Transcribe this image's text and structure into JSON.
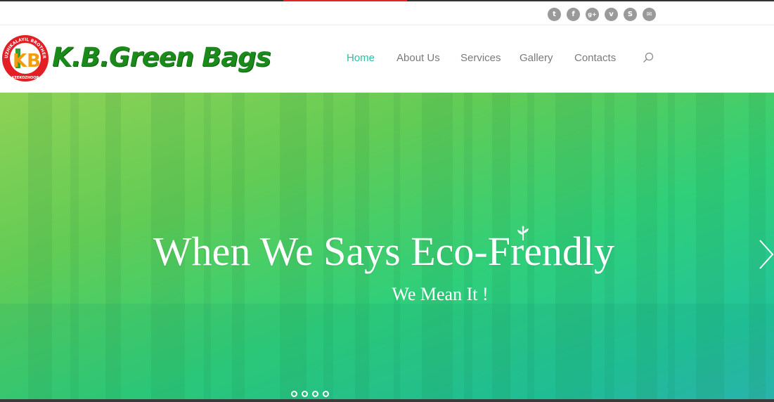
{
  "brand": {
    "name": "K.B.Green Bags",
    "emblem_ring_text": "KUZHIKALAYIL BROTHERS",
    "emblem_bottom_text": "KEEKOZHOOR",
    "emblem_letters": "KB"
  },
  "social": [
    {
      "icon": "twitter-icon",
      "glyph": "t"
    },
    {
      "icon": "facebook-icon",
      "glyph": "f"
    },
    {
      "icon": "google-plus-icon",
      "glyph": "g+"
    },
    {
      "icon": "vimeo-icon",
      "glyph": "v"
    },
    {
      "icon": "skype-icon",
      "glyph": "S"
    },
    {
      "icon": "email-icon",
      "glyph": "✉"
    }
  ],
  "nav": {
    "home": "Home",
    "about": "About Us",
    "services": "Services",
    "gallery": "Gallery",
    "contacts": "Contacts"
  },
  "hero": {
    "title": "When We Says Eco-Frendly",
    "subtitle": "We Mean It !"
  },
  "colors": {
    "accent": "#27c2a5",
    "brand_green": "#1a8a1a",
    "top_red": "#e02424",
    "nav_text": "#7a7a7a"
  }
}
